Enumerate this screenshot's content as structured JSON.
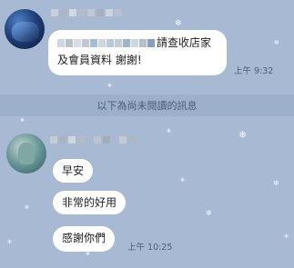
{
  "chat": {
    "messages": [
      {
        "text_line1": "請查收店家",
        "text_line2": "及會員資料 謝謝!",
        "time": "上午 9:32"
      }
    ],
    "unread_divider": "以下為尚未閱讀的訊息",
    "reply": {
      "bubble1": "早安",
      "bubble2": "非常的好用",
      "bubble3": "感謝你們",
      "time": "上午 10:25"
    }
  },
  "colors": {
    "background": "#a7b9d3",
    "bubble": "#ffffff",
    "divider": "#9cb0cc"
  },
  "icons": [
    "snowflake-icon"
  ]
}
